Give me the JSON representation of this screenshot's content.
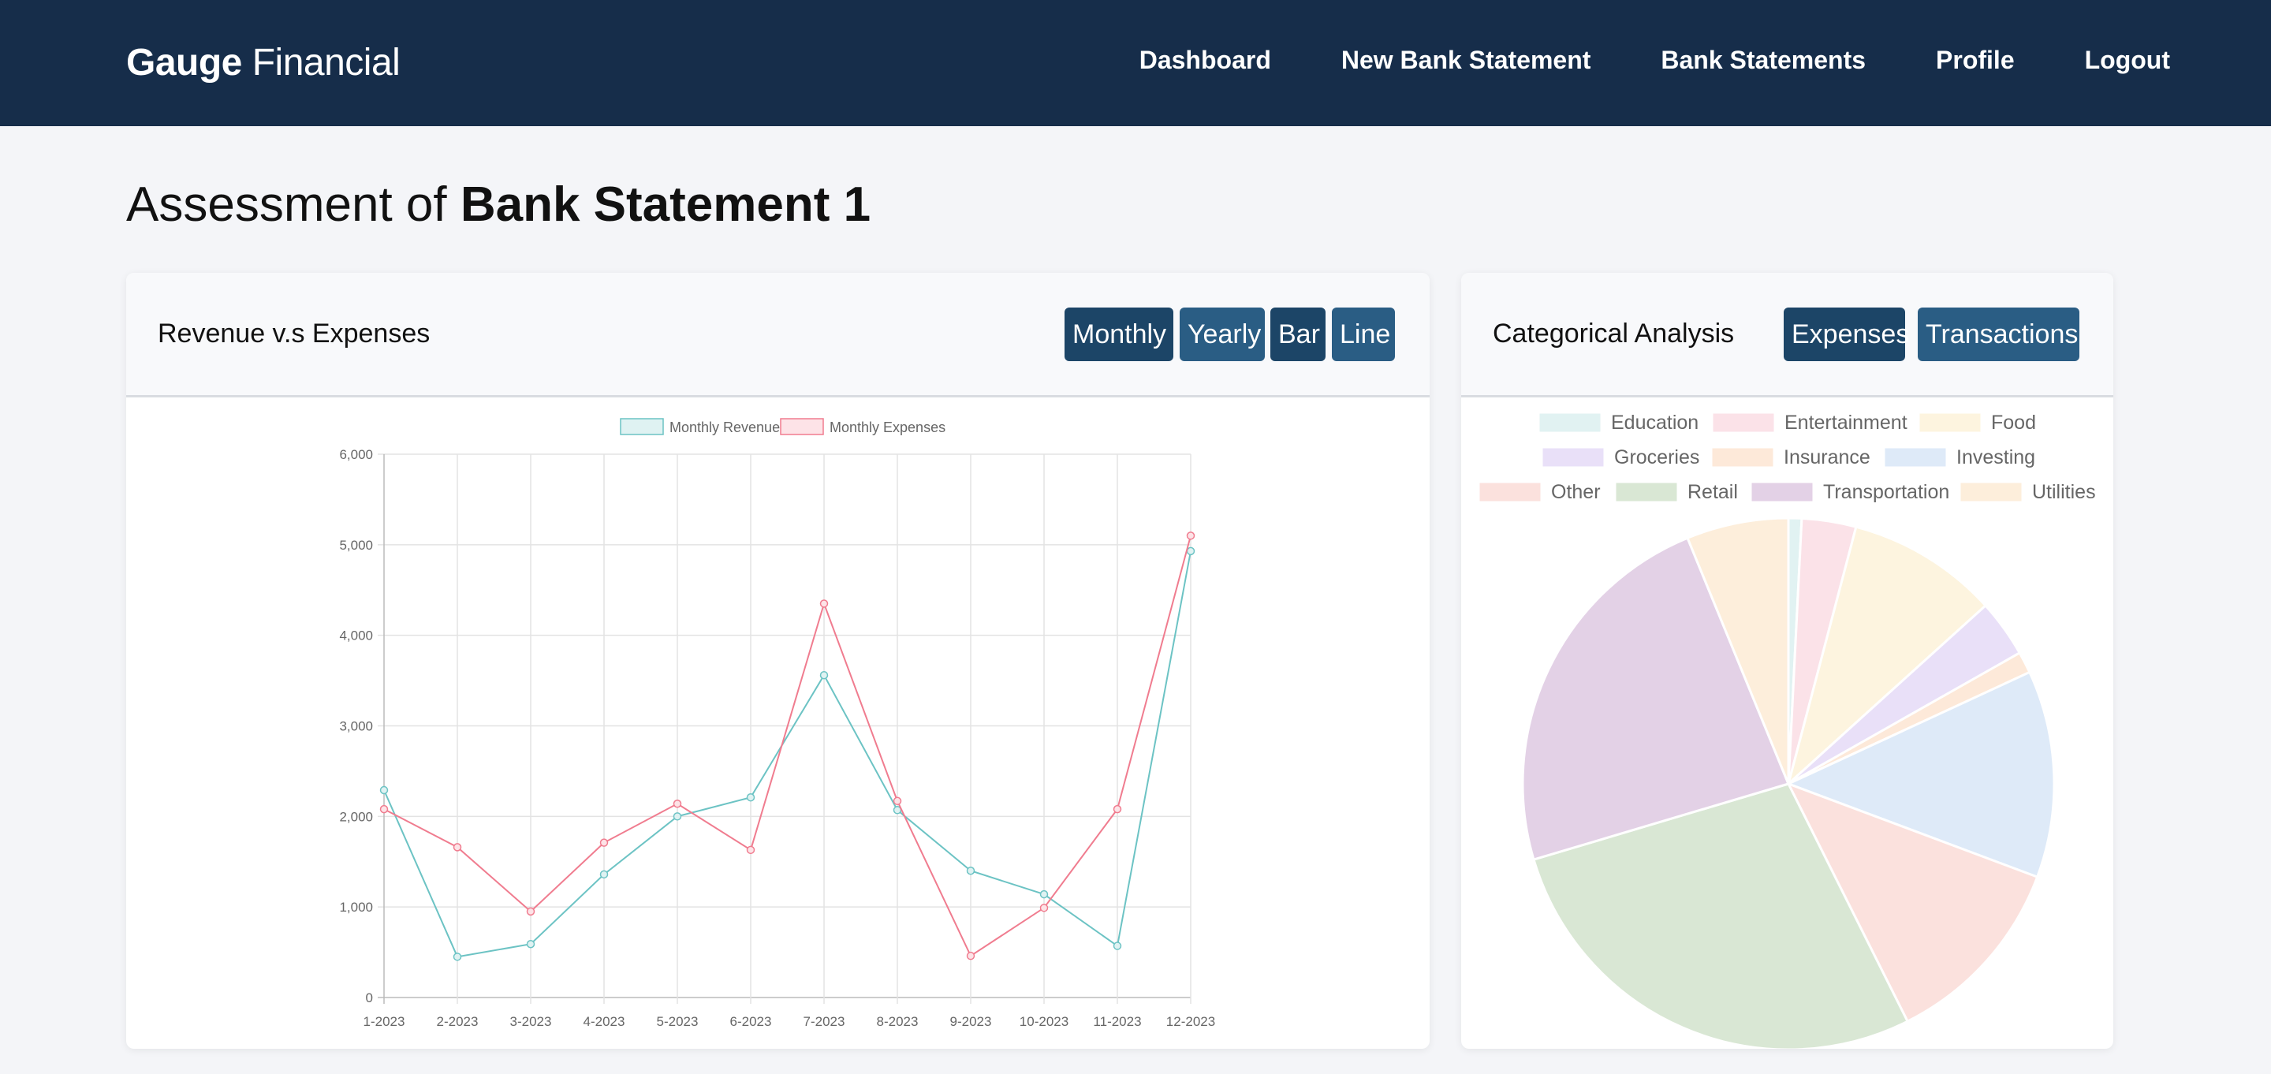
{
  "navbar": {
    "brand_bold": "Gauge",
    "brand_rest": " Financial",
    "links": [
      "Dashboard",
      "New Bank Statement",
      "Bank Statements",
      "Profile",
      "Logout"
    ]
  },
  "page": {
    "title_prefix": "Assessment of ",
    "title_bold": "Bank Statement 1"
  },
  "revenue_card": {
    "title": "Revenue v.s Expenses",
    "buttons": [
      "Monthly",
      "Yearly",
      "Bar",
      "Line"
    ]
  },
  "category_card": {
    "title": "Categorical Analysis",
    "buttons": [
      "Expenses",
      "Transactions"
    ]
  },
  "colors": {
    "navbar": "#162d4a",
    "button": "#2a5d84",
    "button_active": "#1c4567",
    "revenue": "#6cc3c4",
    "expenses": "#f07c8f"
  },
  "chart_data": [
    {
      "type": "line",
      "x": [
        "1-2023",
        "2-2023",
        "3-2023",
        "4-2023",
        "5-2023",
        "6-2023",
        "7-2023",
        "8-2023",
        "9-2023",
        "10-2023",
        "11-2023",
        "12-2023"
      ],
      "series": [
        {
          "name": "Monthly Revenue",
          "color": "#6cc3c4",
          "fill": "#dff2f2",
          "values": [
            2290,
            450,
            590,
            1360,
            2000,
            2210,
            3560,
            2070,
            1400,
            1140,
            570,
            4930
          ]
        },
        {
          "name": "Monthly Expenses",
          "color": "#f07c8f",
          "fill": "#fde3e7",
          "values": [
            2080,
            1660,
            950,
            1710,
            2140,
            1630,
            4350,
            2170,
            460,
            990,
            2080,
            5100
          ]
        }
      ],
      "ylim": [
        0,
        6000
      ],
      "yticks": [
        "0",
        "1,000",
        "2,000",
        "3,000",
        "4,000",
        "5,000",
        "6,000"
      ],
      "legend": "top",
      "grid": true
    },
    {
      "type": "pie",
      "legend": "top",
      "slices": [
        {
          "label": "Education",
          "value": 0.8,
          "color": "#e1f2f2"
        },
        {
          "label": "Entertainment",
          "value": 3.3,
          "color": "#fbe2e8"
        },
        {
          "label": "Food",
          "value": 9.2,
          "color": "#fdf4df"
        },
        {
          "label": "Groceries",
          "value": 3.5,
          "color": "#e9e0f8"
        },
        {
          "label": "Insurance",
          "value": 1.3,
          "color": "#fde9d9"
        },
        {
          "label": "Investing",
          "value": 12.6,
          "color": "#deeaf8"
        },
        {
          "label": "Other",
          "value": 11.9,
          "color": "#fbe1dd"
        },
        {
          "label": "Retail",
          "value": 27.8,
          "color": "#d9e7d4"
        },
        {
          "label": "Transportation",
          "value": 23.4,
          "color": "#e3d1e6"
        },
        {
          "label": "Utilities",
          "value": 6.2,
          "color": "#fdeedb"
        }
      ]
    }
  ]
}
